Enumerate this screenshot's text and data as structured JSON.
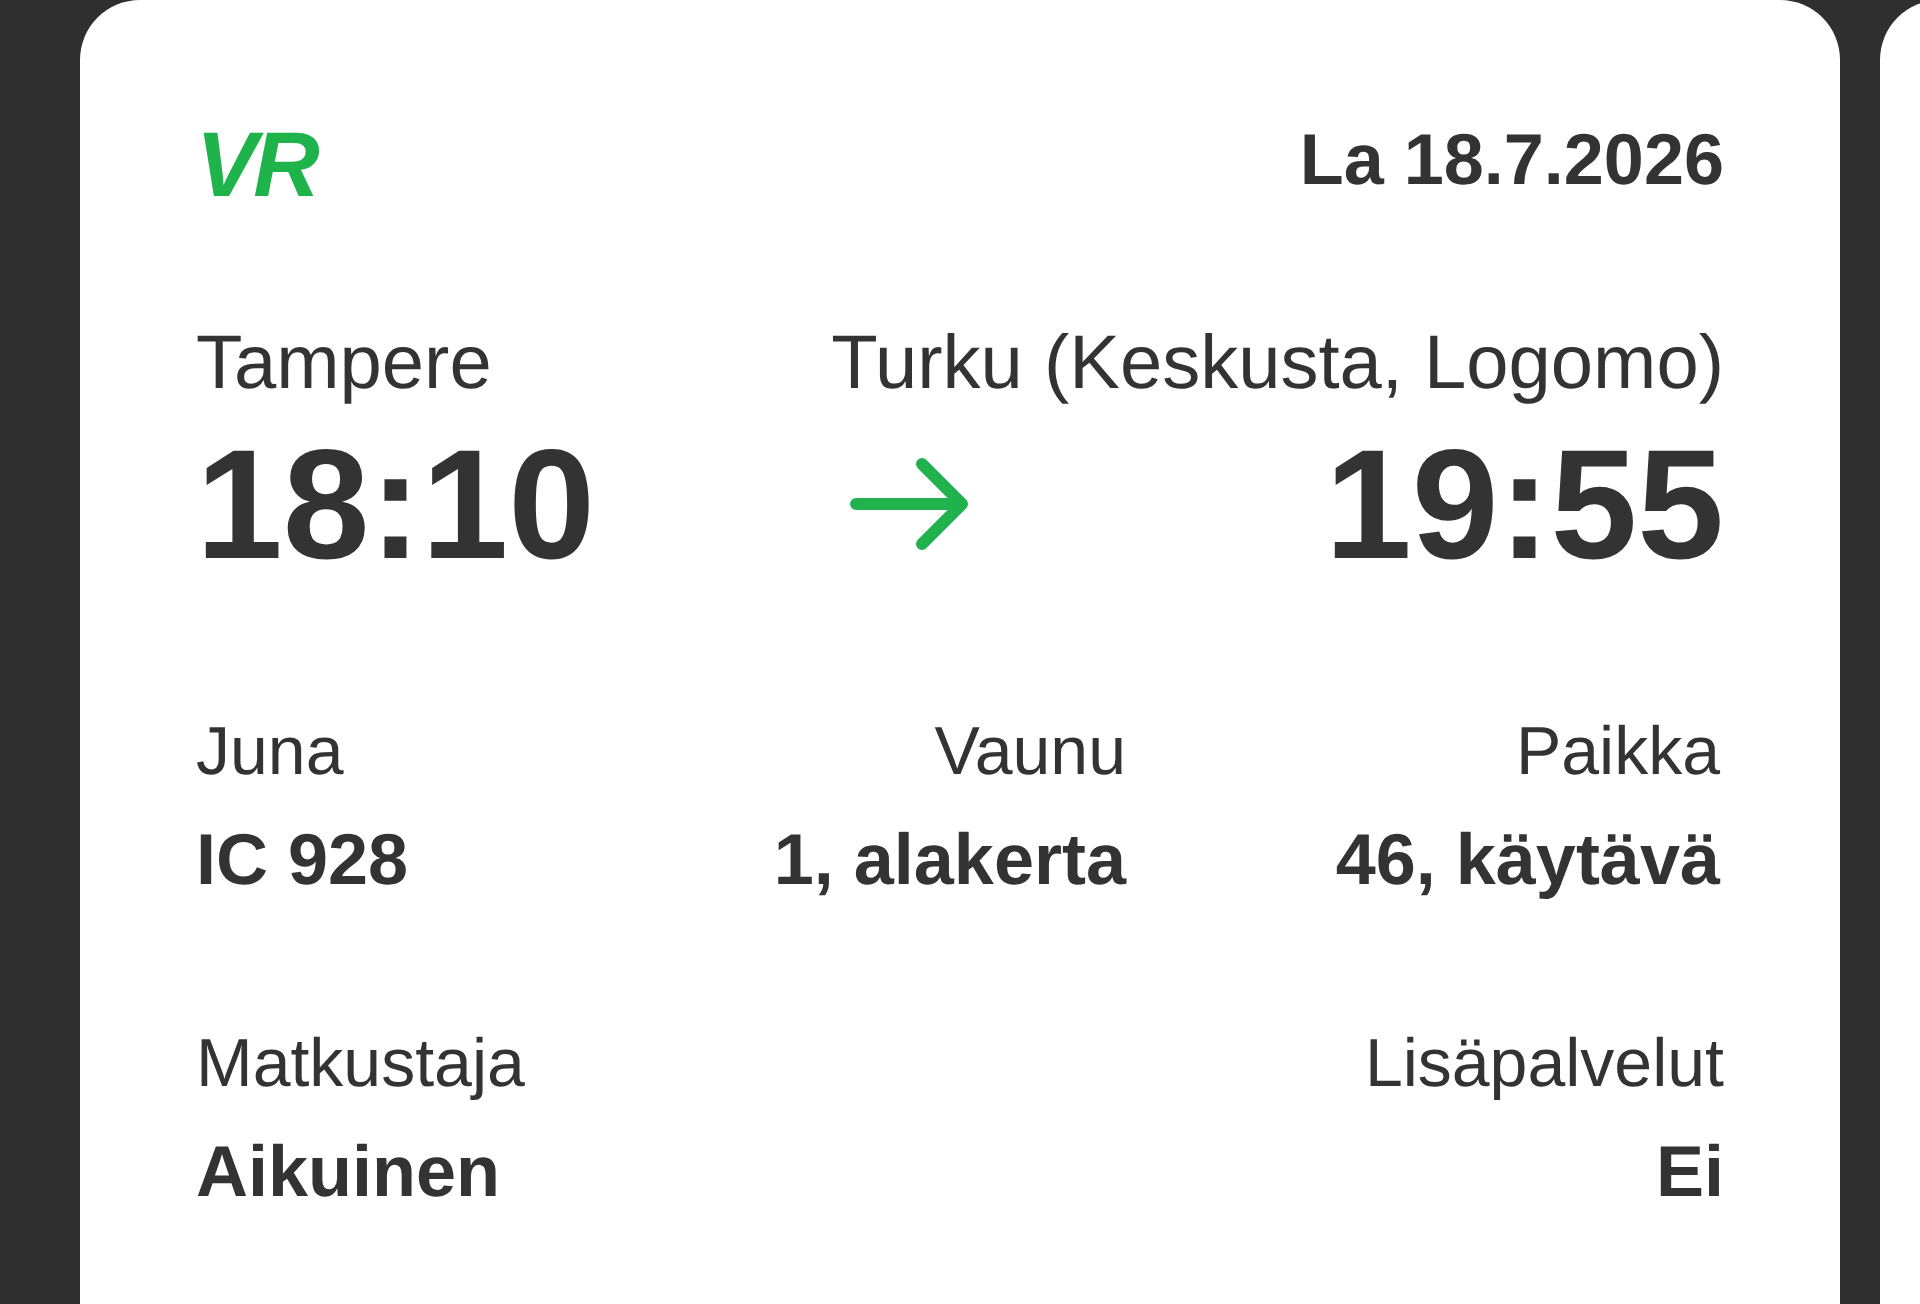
{
  "ticket": {
    "logo": "VR",
    "date": "La 18.7.2026",
    "origin": {
      "station": "Tampere",
      "time": "18:10"
    },
    "destination": {
      "station": "Turku (Keskusta, Logomo)",
      "time": "19:55"
    },
    "details": [
      {
        "label": "Juna",
        "value": "IC 928"
      },
      {
        "label": "Vaunu",
        "value": "1, alakerta"
      },
      {
        "label": "Paikka",
        "value": "46, käytävä"
      }
    ],
    "extras": [
      {
        "label": "Matkustaja",
        "value": "Aikuinen"
      },
      {
        "label": "Lisäpalvelut",
        "value": "Ei"
      }
    ]
  }
}
